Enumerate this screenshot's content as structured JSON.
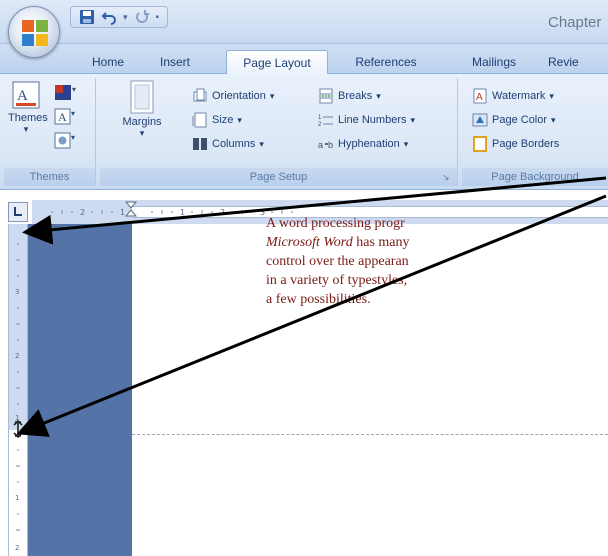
{
  "app": {
    "title": "Chapter"
  },
  "tabs": [
    {
      "label": "Home"
    },
    {
      "label": "Insert"
    },
    {
      "label": "Page Layout"
    },
    {
      "label": "References"
    },
    {
      "label": "Mailings"
    },
    {
      "label": "Revie"
    }
  ],
  "ribbon": {
    "themes": {
      "themes_label": "Themes",
      "group_label": "Themes"
    },
    "page_setup": {
      "margins_label": "Margins",
      "orientation_label": "Orientation",
      "size_label": "Size",
      "columns_label": "Columns",
      "breaks_label": "Breaks",
      "line_numbers_label": "Line Numbers",
      "hyphenation_label": "Hyphenation",
      "group_label": "Page Setup"
    },
    "page_background": {
      "watermark_label": "Watermark",
      "page_color_label": "Page Color",
      "page_borders_label": "Page Borders",
      "group_label": "Page Background"
    }
  },
  "document": {
    "line1": "A word processing progr",
    "line2_italic": "Microsoft Word",
    "line2_rest": " has many",
    "line3": "control over the appearan",
    "line4": "in a variety of typestyles,",
    "line5": "a few possibilities."
  },
  "colors": {
    "ribbon_bg": "#dbe7f6",
    "workspace": "#5474a8",
    "doc_text": "#7a1a14",
    "arrow": "#000000"
  },
  "icons": [
    "office-button-icon",
    "save-icon",
    "undo-icon",
    "redo-icon",
    "qat-dropdown-icon",
    "themes-icon",
    "colors-icon",
    "fonts-icon",
    "effects-icon",
    "margins-icon",
    "orientation-icon",
    "size-icon",
    "columns-icon",
    "breaks-icon",
    "line-numbers-icon",
    "hyphenation-icon",
    "watermark-icon",
    "page-color-icon",
    "page-borders-icon",
    "tab-stop-icon",
    "indent-marker-icon",
    "margin-marker-icon"
  ]
}
